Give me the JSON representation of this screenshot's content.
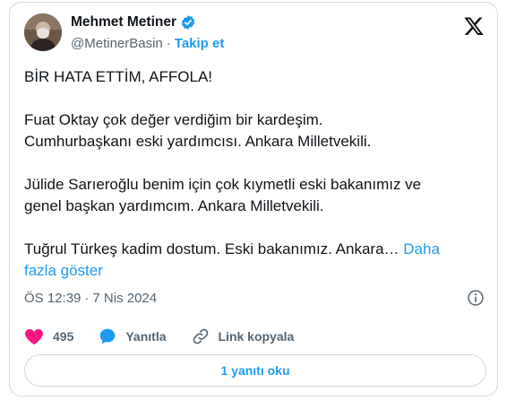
{
  "author": {
    "name": "Mehmet Metiner",
    "handle": "@MetinerBasin",
    "separator": "·",
    "follow_label": "Takip et"
  },
  "tweet": {
    "paragraphs": [
      "BİR HATA ETTİM, AFFOLA!",
      "Fuat Oktay çok değer verdiğim bir kardeşim.\nCumhurbaşkanı eski yardımcısı. Ankara Milletvekili.",
      "Jülide Sarıeroğlu benim için çok kıymetli eski bakanımız ve\ngenel başkan yardımcım. Ankara Milletvekili."
    ],
    "last_paragraph": "Tuğrul Türkeş kadim dostum. Eski bakanımız. Ankara… ",
    "show_more": "Daha\nfazla göster"
  },
  "meta": {
    "time": "ÖS 12:39",
    "separator": "·",
    "date": "7 Nis 2024"
  },
  "actions": {
    "like_count": "495",
    "reply_label": "Yanıtla",
    "copy_link_label": "Link kopyala"
  },
  "read_replies_label": "1 yanıtı oku",
  "colors": {
    "accent": "#1d9bf0",
    "like": "#f91880",
    "text": "#0f1419",
    "secondary": "#536471",
    "border": "#cfd9de"
  }
}
